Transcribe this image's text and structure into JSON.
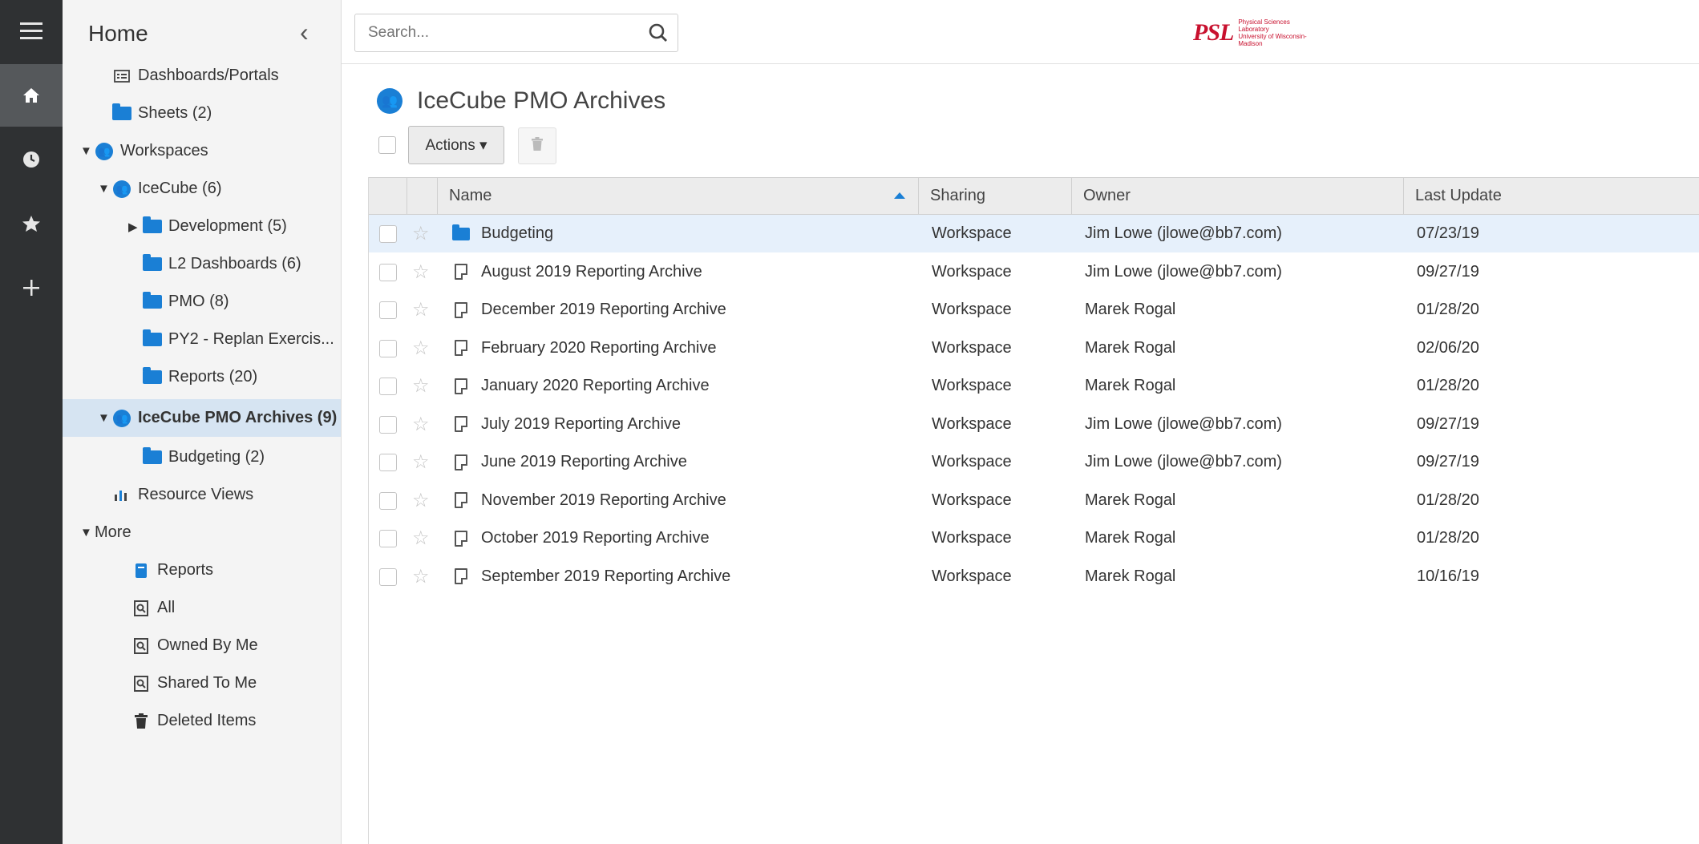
{
  "rail": {
    "items": [
      {
        "name": "menu",
        "glyph": "≡"
      },
      {
        "name": "home",
        "glyph": "⌂"
      },
      {
        "name": "recents",
        "glyph": "◷"
      },
      {
        "name": "favorites",
        "glyph": "★"
      },
      {
        "name": "create",
        "glyph": "+"
      }
    ]
  },
  "nav": {
    "title": "Home",
    "collapse_glyph": "‹",
    "items": [
      {
        "label": "Dashboards/Portals"
      },
      {
        "label": "Sheets (2)"
      },
      {
        "label": "Workspaces"
      },
      {
        "label": "IceCube (6)"
      },
      {
        "label": "Development (5)"
      },
      {
        "label": "L2 Dashboards (6)"
      },
      {
        "label": "PMO (8)"
      },
      {
        "label": "PY2 - Replan Exercis..."
      },
      {
        "label": "Reports (20)"
      },
      {
        "label": "IceCube PMO Archives (9)"
      },
      {
        "label": "Budgeting (2)"
      },
      {
        "label": "Resource Views"
      },
      {
        "label": "More"
      },
      {
        "label": "Reports"
      },
      {
        "label": "All"
      },
      {
        "label": "Owned By Me"
      },
      {
        "label": "Shared To Me"
      },
      {
        "label": "Deleted Items"
      }
    ]
  },
  "search": {
    "placeholder": "Search...",
    "value": ""
  },
  "logo": {
    "mark": "PSL",
    "line1": "Physical Sciences Laboratory",
    "line2": "University of Wisconsin-Madison"
  },
  "page": {
    "title": "IceCube PMO Archives"
  },
  "toolbar": {
    "actions_label": "Actions ▾"
  },
  "table": {
    "columns": [
      "Name",
      "Sharing",
      "Owner",
      "Last Update"
    ],
    "rows": [
      {
        "name": "Budgeting",
        "sharing": "Workspace",
        "owner": "Jim Lowe (jlowe@bb7.com)",
        "updated": "07/23/19"
      },
      {
        "name": "August 2019 Reporting Archive",
        "sharing": "Workspace",
        "owner": "Jim Lowe (jlowe@bb7.com)",
        "updated": "09/27/19"
      },
      {
        "name": "December 2019 Reporting Archive",
        "sharing": "Workspace",
        "owner": "Marek Rogal",
        "updated": "01/28/20"
      },
      {
        "name": "February 2020 Reporting Archive",
        "sharing": "Workspace",
        "owner": "Marek Rogal",
        "updated": "02/06/20"
      },
      {
        "name": "January 2020 Reporting Archive",
        "sharing": "Workspace",
        "owner": "Marek Rogal",
        "updated": "01/28/20"
      },
      {
        "name": "July 2019 Reporting Archive",
        "sharing": "Workspace",
        "owner": "Jim Lowe (jlowe@bb7.com)",
        "updated": "09/27/19"
      },
      {
        "name": "June 2019 Reporting Archive",
        "sharing": "Workspace",
        "owner": "Jim Lowe (jlowe@bb7.com)",
        "updated": "09/27/19"
      },
      {
        "name": "November 2019 Reporting Archive",
        "sharing": "Workspace",
        "owner": "Marek Rogal",
        "updated": "01/28/20"
      },
      {
        "name": "October 2019 Reporting Archive",
        "sharing": "Workspace",
        "owner": "Marek Rogal",
        "updated": "01/28/20"
      },
      {
        "name": "September 2019 Reporting Archive",
        "sharing": "Workspace",
        "owner": "Marek Rogal",
        "updated": "10/16/19"
      }
    ]
  },
  "colors": {
    "accent": "#1a7fd5",
    "rail": "#2f3133",
    "selected_row": "#e6f0fb",
    "brand": "#c8102e"
  }
}
